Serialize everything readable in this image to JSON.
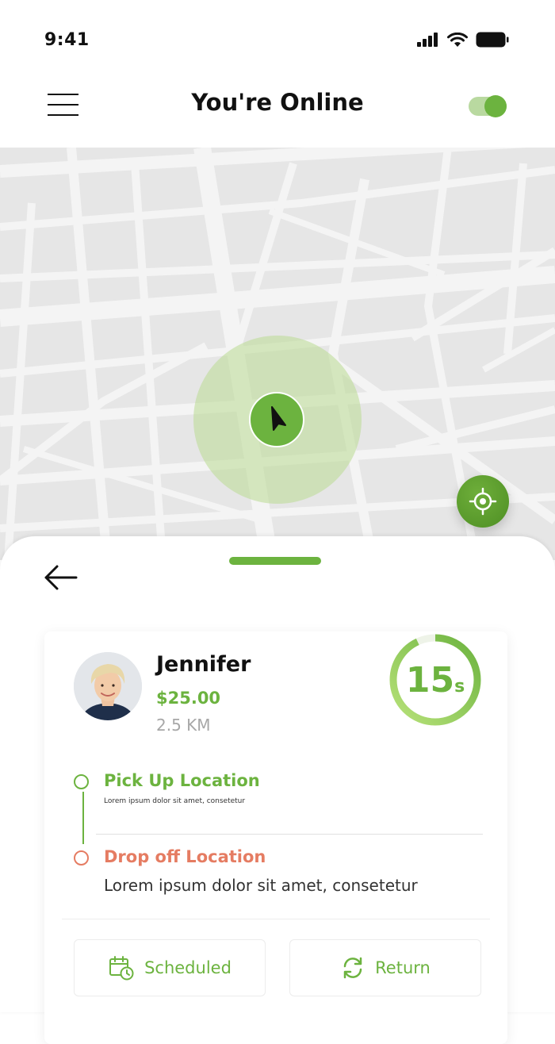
{
  "status_bar": {
    "time": "9:41",
    "icons": [
      "cellular-signal-icon",
      "wifi-icon",
      "battery-icon"
    ]
  },
  "header": {
    "title": "You're Online",
    "menu_icon": "hamburger-menu-icon",
    "online_toggle": {
      "state": "on"
    }
  },
  "map": {
    "driver_marker_icon": "navigation-arrow-icon",
    "locate_icon": "crosshair-target-icon"
  },
  "sheet": {
    "back_icon": "arrow-left-icon",
    "request": {
      "rider_name": "Jennifer",
      "fare": "$25.00",
      "distance": "2.5 KM",
      "timer": {
        "value": "15",
        "unit": "s",
        "remaining_fraction": 0.93
      },
      "pickup": {
        "title": "Pick Up Location",
        "address": "Lorem ipsum dolor sit amet, consetetur"
      },
      "dropoff": {
        "title": "Drop off Location",
        "address": "Lorem ipsum dolor sit amet, consetetur"
      },
      "actions": {
        "scheduled_label": "Scheduled",
        "scheduled_icon": "calendar-clock-icon",
        "return_label": "Return",
        "return_icon": "refresh-arrows-icon"
      }
    }
  },
  "colors": {
    "accent_green": "#6cb33f",
    "dropoff_orange": "#e57c62",
    "map_background": "#e6e6e6",
    "map_roads": "#f4f4f4"
  }
}
